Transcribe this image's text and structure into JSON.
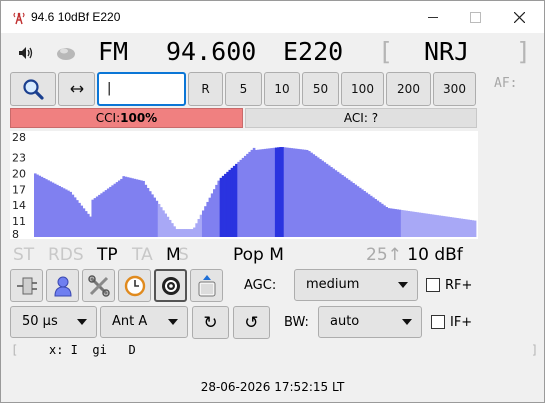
{
  "window": {
    "title": "94.6 10dBf E220"
  },
  "tuner": {
    "mode": "FM",
    "frequency": "94.600",
    "pi_code": "E220",
    "ps_open": "[",
    "ps_name": "NRJ",
    "ps_close": "]",
    "af_label": "AF:"
  },
  "toolbar": {
    "frequency_input": "",
    "r_label": "R",
    "steps": [
      "5",
      "10",
      "50",
      "100",
      "200",
      "300"
    ]
  },
  "bars": {
    "cci_label": "CCI: ",
    "cci_value": "100%",
    "aci_label": "ACI: ?"
  },
  "chart_data": {
    "type": "area",
    "y_ticks": [
      "28",
      "23",
      "20",
      "17",
      "14",
      "11",
      "8"
    ],
    "ylim": [
      8,
      28
    ],
    "x_count": 200,
    "series_color": "#8080f0",
    "highlight_color": "#2a33e0",
    "light_color": "#a8a8f6",
    "values_description_free": true
  },
  "rds": {
    "flags": {
      "st": "ST",
      "rds": "RDS",
      "tp": "TP",
      "ta": "TA",
      "m": "M",
      "s": "S"
    },
    "pty": "Pop M",
    "signal_arrow_value": "25↑",
    "signal_value": "10 dBf"
  },
  "controls": {
    "agc_label": "AGC:",
    "agc_value": "medium",
    "rf_label": "RF+",
    "deemphasis_value": "50 µs",
    "antenna_value": "Ant A",
    "bw_label": "BW:",
    "bw_value": "auto",
    "if_label": "IF+",
    "rotate_cw": "↻",
    "rotate_ccw": "↺"
  },
  "radiotext": {
    "open": "[",
    "text": "x: I  gi   D",
    "close": "]"
  },
  "status": {
    "clock": "28-06-2026 17:52:15 LT"
  },
  "colors": {
    "accent": "#0b76d6",
    "cci_bar": "#f08080",
    "aci_bar": "#e0e0e0"
  }
}
